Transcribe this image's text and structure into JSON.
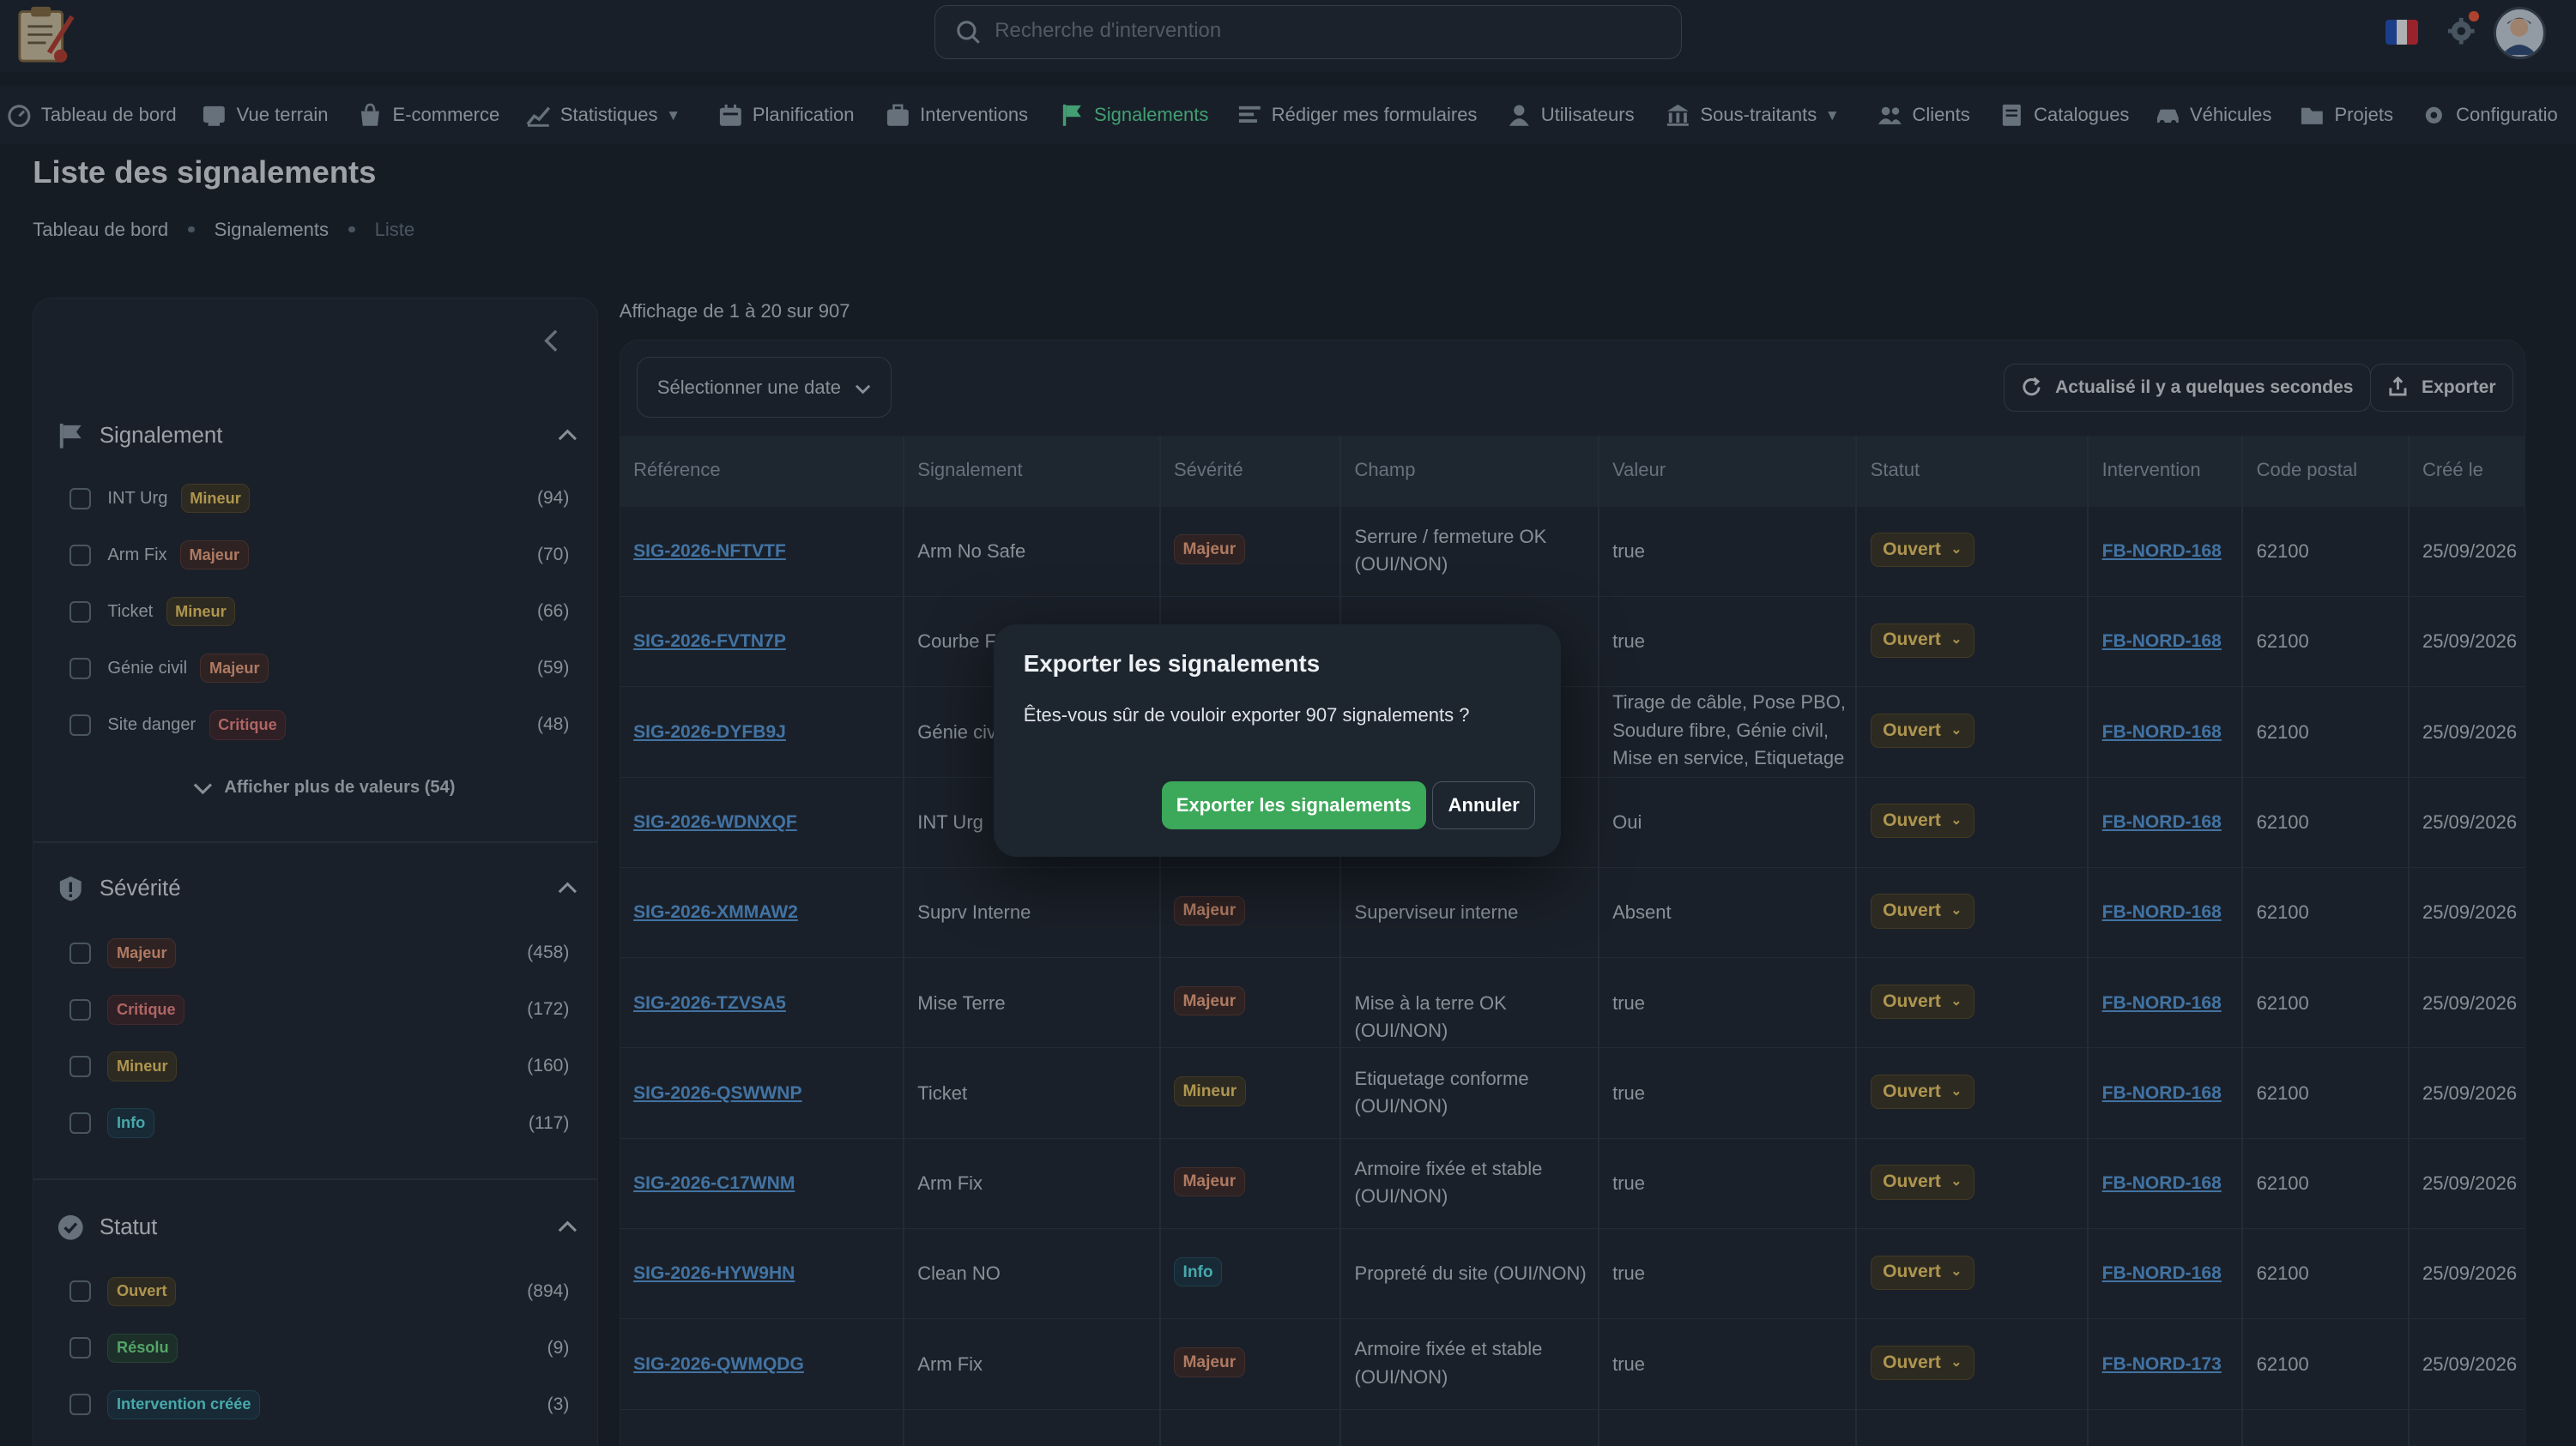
{
  "search": {
    "placeholder": "Recherche d'intervention"
  },
  "nav": [
    {
      "label": "Tableau de bord",
      "icon": "dashboard-icon",
      "chevron": false
    },
    {
      "label": "Vue terrain",
      "icon": "map-view-icon",
      "chevron": false
    },
    {
      "label": "E-commerce",
      "icon": "shopping-bag-icon",
      "chevron": false
    },
    {
      "label": "Statistiques",
      "icon": "chart-icon",
      "chevron": true
    },
    {
      "label": "Planification",
      "icon": "calendar-icon",
      "chevron": false
    },
    {
      "label": "Interventions",
      "icon": "briefcase-icon",
      "chevron": false
    },
    {
      "label": "Signalements",
      "icon": "flag-icon",
      "chevron": false,
      "active": true
    },
    {
      "label": "Rédiger mes formulaires",
      "icon": "form-icon",
      "chevron": false
    },
    {
      "label": "Utilisateurs",
      "icon": "user-icon",
      "chevron": false
    },
    {
      "label": "Sous-traitants",
      "icon": "building-icon",
      "chevron": true
    },
    {
      "label": "Clients",
      "icon": "clients-icon",
      "chevron": false
    },
    {
      "label": "Catalogues",
      "icon": "catalog-icon",
      "chevron": false
    },
    {
      "label": "Véhicules",
      "icon": "car-icon",
      "chevron": false
    },
    {
      "label": "Projets",
      "icon": "folder-icon",
      "chevron": false
    },
    {
      "label": "Configuratio",
      "icon": "settings-icon",
      "chevron": false
    }
  ],
  "page": {
    "title": "Liste des signalements"
  },
  "breadcrumb": [
    "Tableau de bord",
    "Signalements",
    "Liste"
  ],
  "filters": {
    "signalement": {
      "title": "Signalement",
      "items": [
        {
          "label": "INT Urg",
          "chip": "Mineur",
          "tone": "min",
          "count": "(94)"
        },
        {
          "label": "Arm Fix",
          "chip": "Majeur",
          "tone": "maj",
          "count": "(70)"
        },
        {
          "label": "Ticket",
          "chip": "Mineur",
          "tone": "min",
          "count": "(66)"
        },
        {
          "label": "Génie civil",
          "chip": "Majeur",
          "tone": "maj",
          "count": "(59)"
        },
        {
          "label": "Site danger",
          "chip": "Critique",
          "tone": "crit",
          "count": "(48)"
        }
      ],
      "show_more": "Afficher plus de valeurs (54)"
    },
    "severite": {
      "title": "Sévérité",
      "items": [
        {
          "chip": "Majeur",
          "tone": "maj",
          "count": "(458)"
        },
        {
          "chip": "Critique",
          "tone": "crit",
          "count": "(172)"
        },
        {
          "chip": "Mineur",
          "tone": "min",
          "count": "(160)"
        },
        {
          "chip": "Info",
          "tone": "info",
          "count": "(117)"
        }
      ]
    },
    "statut": {
      "title": "Statut",
      "items": [
        {
          "chip": "Ouvert",
          "tone": "open",
          "count": "(894)"
        },
        {
          "chip": "Résolu",
          "tone": "res",
          "count": "(9)"
        },
        {
          "chip": "Intervention créée",
          "tone": "intv",
          "count": "(3)"
        }
      ]
    }
  },
  "showing": "Affichage de 1 à 20 sur 907",
  "toolbar": {
    "date_placeholder": "Sélectionner une date",
    "refresh_label": "Actualisé il y a quelques secondes",
    "export_label": "Exporter"
  },
  "table": {
    "columns": [
      "Référence",
      "Signalement",
      "Sévérité",
      "Champ",
      "Valeur",
      "Statut",
      "Intervention",
      "Code postal",
      "Créé le"
    ],
    "rows": [
      {
        "ref": "SIG-2026-NFTVTF",
        "sig": "Arm No Safe",
        "sev": "Majeur",
        "sevtone": "maj",
        "champ": "Serrure / fermeture OK (OUI/NON)",
        "valeur": "true",
        "statut": "Ouvert",
        "interv": "FB-NORD-168",
        "cp": "62100",
        "date": "25/09/2026"
      },
      {
        "ref": "SIG-2026-FVTN7P",
        "sig": "Courbe F",
        "sev": "",
        "sevtone": "",
        "champ": "",
        "valeur": "true",
        "statut": "Ouvert",
        "interv": "FB-NORD-168",
        "cp": "62100",
        "date": "25/09/2026"
      },
      {
        "ref": "SIG-2026-DYFB9J",
        "sig": "Génie civ",
        "sev": "",
        "sevtone": "",
        "champ": "",
        "valeur": "Tirage de câble, Pose PBO, Soudure fibre, Génie civil, Mise en service, Etiquetage",
        "statut": "Ouvert",
        "interv": "FB-NORD-168",
        "cp": "62100",
        "date": "25/09/2026"
      },
      {
        "ref": "SIG-2026-WDNXQF",
        "sig": "INT Urg",
        "sev": "",
        "sevtone": "",
        "champ": "",
        "valeur": "Oui",
        "statut": "Ouvert",
        "interv": "FB-NORD-168",
        "cp": "62100",
        "date": "25/09/2026"
      },
      {
        "ref": "SIG-2026-XMMAW2",
        "sig": "Suprv Interne",
        "sev": "Majeur",
        "sevtone": "maj",
        "champ": "Superviseur interne",
        "valeur": "Absent",
        "statut": "Ouvert",
        "interv": "FB-NORD-168",
        "cp": "62100",
        "date": "25/09/2026"
      },
      {
        "ref": "SIG-2026-TZVSA5",
        "sig": "Mise Terre",
        "sev": "Majeur",
        "sevtone": "maj",
        "champ": "Mise à la terre OK (OUI/NON)",
        "valeur": "true",
        "statut": "Ouvert",
        "interv": "FB-NORD-168",
        "cp": "62100",
        "date": "25/09/2026"
      },
      {
        "ref": "SIG-2026-QSWWNP",
        "sig": "Ticket",
        "sev": "Mineur",
        "sevtone": "min",
        "champ": "Etiquetage conforme (OUI/NON)",
        "valeur": "true",
        "statut": "Ouvert",
        "interv": "FB-NORD-168",
        "cp": "62100",
        "date": "25/09/2026"
      },
      {
        "ref": "SIG-2026-C17WNM",
        "sig": "Arm Fix",
        "sev": "Majeur",
        "sevtone": "maj",
        "champ": "Armoire fixée et stable (OUI/NON)",
        "valeur": "true",
        "statut": "Ouvert",
        "interv": "FB-NORD-168",
        "cp": "62100",
        "date": "25/09/2026"
      },
      {
        "ref": "SIG-2026-HYW9HN",
        "sig": "Clean NO",
        "sev": "Info",
        "sevtone": "info",
        "champ": "Propreté du site (OUI/NON)",
        "valeur": "true",
        "statut": "Ouvert",
        "interv": "FB-NORD-168",
        "cp": "62100",
        "date": "25/09/2026"
      },
      {
        "ref": "SIG-2026-QWMQDG",
        "sig": "Arm Fix",
        "sev": "Majeur",
        "sevtone": "maj",
        "champ": "Armoire fixée et stable (OUI/NON)",
        "valeur": "true",
        "statut": "Ouvert",
        "interv": "FB-NORD-173",
        "cp": "62100",
        "date": "25/09/2026"
      }
    ]
  },
  "modal": {
    "title": "Exporter les signalements",
    "message": "Êtes-vous sûr de vouloir exporter 907 signalements ?",
    "confirm": "Exporter les signalements",
    "cancel": "Annuler"
  },
  "colors": {
    "accent": "#5be49b",
    "confirm": "#3ca85a",
    "link": "#5aa2e6",
    "background": "#161c24"
  }
}
